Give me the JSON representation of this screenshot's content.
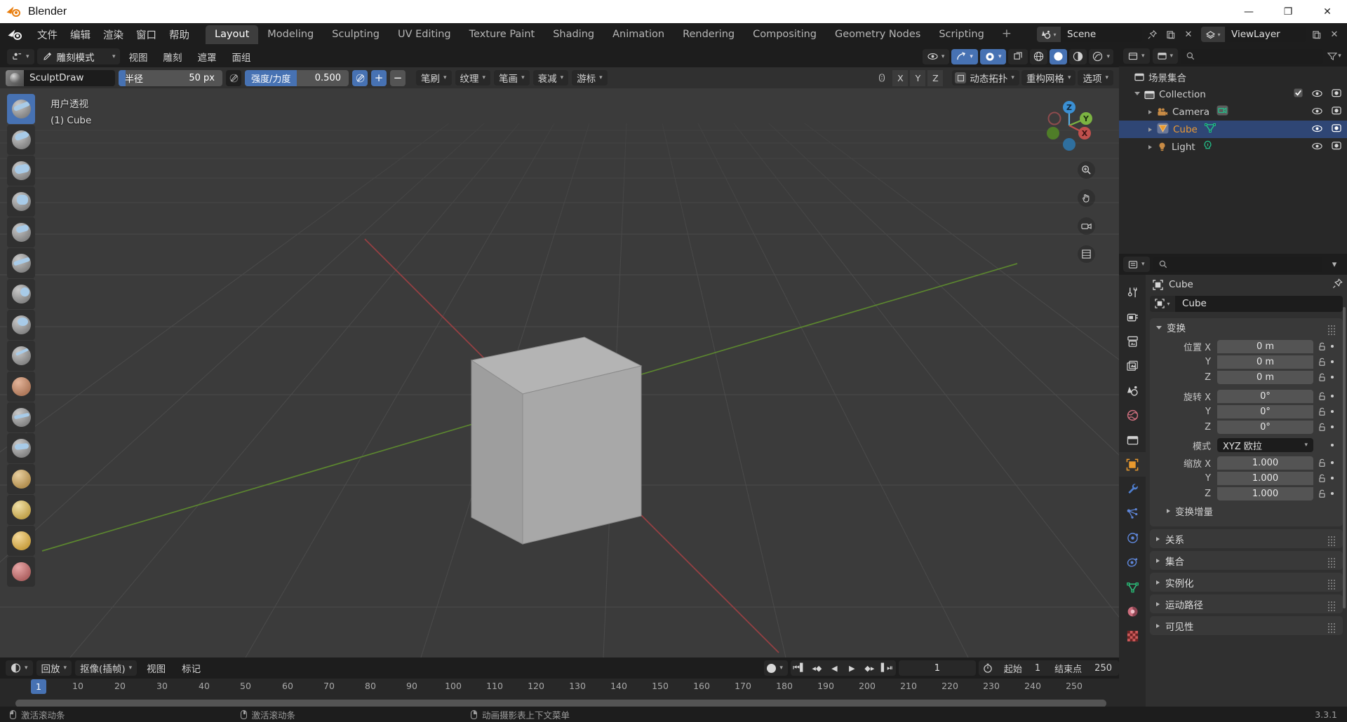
{
  "window": {
    "title": "Blender",
    "minimize": "—",
    "maximize": "❐",
    "close": "✕"
  },
  "topbar": {
    "menus": [
      "文件",
      "编辑",
      "渲染",
      "窗口",
      "帮助"
    ],
    "workspaces": [
      {
        "label": "Layout",
        "active": true
      },
      {
        "label": "Modeling",
        "active": false
      },
      {
        "label": "Sculpting",
        "active": false
      },
      {
        "label": "UV Editing",
        "active": false
      },
      {
        "label": "Texture Paint",
        "active": false
      },
      {
        "label": "Shading",
        "active": false
      },
      {
        "label": "Animation",
        "active": false
      },
      {
        "label": "Rendering",
        "active": false
      },
      {
        "label": "Compositing",
        "active": false
      },
      {
        "label": "Geometry Nodes",
        "active": false
      },
      {
        "label": "Scripting",
        "active": false
      }
    ],
    "add_workspace": "+",
    "scene_name": "Scene",
    "viewlayer_name": "ViewLayer"
  },
  "viewport_header": {
    "editor_type_icon": "editor-type-icon",
    "mode": "雕刻模式",
    "menus": [
      "视图",
      "雕刻",
      "遮罩",
      "面组"
    ]
  },
  "tool_settings": {
    "brush_name": "SculptDraw",
    "radius": {
      "label": "半径",
      "value": "50 px",
      "fill_pct": 7
    },
    "strength": {
      "label": "强度/力度",
      "value": "0.500",
      "fill_pct": 50
    },
    "add_label": "+",
    "subtract_label": "−",
    "popovers": [
      "笔刷",
      "纹理",
      "笔画",
      "衰减",
      "游标"
    ],
    "axes": [
      "X",
      "Y",
      "Z"
    ],
    "dyntopo": "动态拓扑",
    "remesh": "重构网格",
    "options": "选项"
  },
  "viewport": {
    "view_name": "用户透视",
    "active_object": "(1) Cube",
    "gizmo_axes": [
      "X",
      "Y",
      "Z"
    ],
    "background_color": "#3b3b3b"
  },
  "outliner": {
    "scene_collection": "场景集合",
    "rows": [
      {
        "label": "Collection",
        "type": "collection",
        "indent": 1,
        "expanded": true,
        "checkbox": true,
        "selected": false
      },
      {
        "label": "Camera",
        "type": "camera",
        "indent": 2,
        "expanded": false,
        "checkbox": false,
        "selected": false
      },
      {
        "label": "Cube",
        "type": "mesh",
        "indent": 2,
        "expanded": false,
        "checkbox": false,
        "selected": true
      },
      {
        "label": "Light",
        "type": "light",
        "indent": 2,
        "expanded": false,
        "checkbox": false,
        "selected": false
      }
    ]
  },
  "properties": {
    "breadcrumb_object": "Cube",
    "object_name": "Cube",
    "transform": {
      "title": "变换",
      "location_label": "位置",
      "location": [
        {
          "axis": "X",
          "value": "0 m"
        },
        {
          "axis": "Y",
          "value": "0 m"
        },
        {
          "axis": "Z",
          "value": "0 m"
        }
      ],
      "rotation_label": "旋转",
      "rotation": [
        {
          "axis": "X",
          "value": "0°"
        },
        {
          "axis": "Y",
          "value": "0°"
        },
        {
          "axis": "Z",
          "value": "0°"
        }
      ],
      "mode_label": "模式",
      "mode_value": "XYZ 欧拉",
      "scale_label": "缩放",
      "scale": [
        {
          "axis": "X",
          "value": "1.000"
        },
        {
          "axis": "Y",
          "value": "1.000"
        },
        {
          "axis": "Z",
          "value": "1.000"
        }
      ],
      "delta_transform": "变换增量"
    },
    "collapsed_panels": [
      "关系",
      "集合",
      "实例化",
      "运动路径",
      "可见性"
    ],
    "tabs": [
      {
        "name": "tool",
        "color": "#d0d0d0"
      },
      {
        "name": "render",
        "color": "#d0d0d0"
      },
      {
        "name": "output",
        "color": "#d0d0d0"
      },
      {
        "name": "view-layer",
        "color": "#d0d0d0"
      },
      {
        "name": "scene",
        "color": "#d0d0d0"
      },
      {
        "name": "world",
        "color": "#cc6e7d"
      },
      {
        "name": "collection",
        "color": "#d0d0d0"
      },
      {
        "name": "object",
        "color": "#e8992e",
        "active": true
      },
      {
        "name": "modifiers",
        "color": "#4f7fd0"
      },
      {
        "name": "particles",
        "color": "#5e86d8"
      },
      {
        "name": "physics",
        "color": "#5e86d8"
      },
      {
        "name": "constraints",
        "color": "#5e86d8"
      },
      {
        "name": "data",
        "color": "#2ec27e"
      },
      {
        "name": "material",
        "color": "#cc6e7d"
      },
      {
        "name": "texture",
        "color": "#cc5a5a"
      }
    ]
  },
  "timeline": {
    "menus": [
      "回放",
      "抠像(插帧)",
      "视图",
      "标记"
    ],
    "current_frame": "1",
    "start_label": "起始",
    "start_value": "1",
    "end_label": "结束点",
    "end_value": "250",
    "ticks": [
      1,
      10,
      20,
      30,
      40,
      50,
      60,
      70,
      80,
      90,
      100,
      110,
      120,
      130,
      140,
      150,
      160,
      170,
      180,
      190,
      200,
      210,
      220,
      230,
      240,
      250
    ],
    "playhead_frame": "1"
  },
  "statusbar": {
    "items": [
      "激活滚动条",
      "激活滚动条",
      "动画摄影表上下文菜单"
    ],
    "version": "3.3.1"
  }
}
